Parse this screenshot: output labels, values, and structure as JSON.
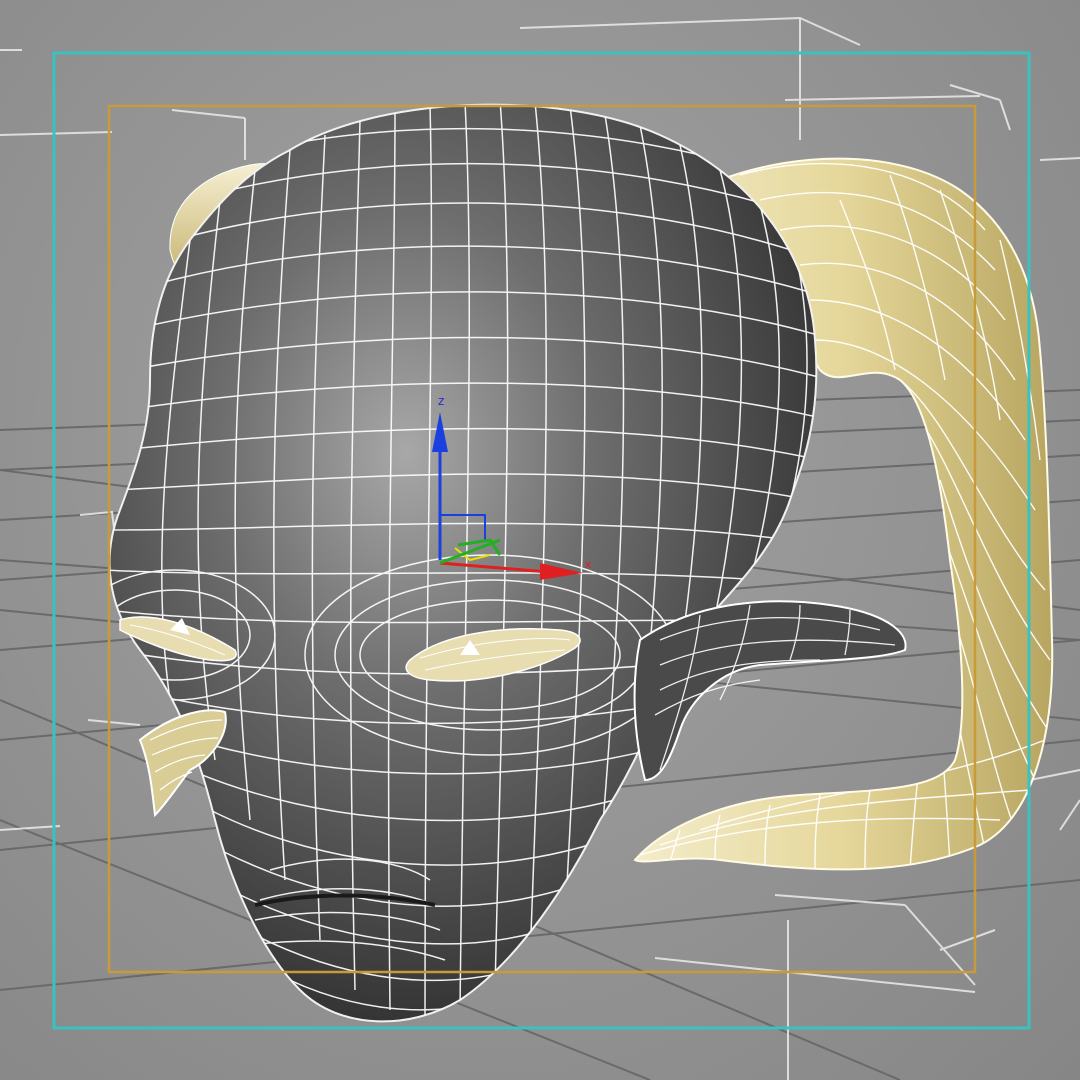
{
  "viewport": {
    "background": "#8f8f8f",
    "grid_color": "#5c5c5c",
    "safe_frame_color": "#39c2c2",
    "selection_frame_color": "#c89a3a",
    "bbox_color": "#e6e6e6"
  },
  "model": {
    "head_color": "#3f3f3f",
    "head_highlight": "#9a9a9a",
    "horn_color": "#e8dca0",
    "horn_shadow": "#b9a766",
    "wire_color": "#ffffff",
    "eye_color": "#e7ddb0"
  },
  "gizmo": {
    "x_color": "#e02020",
    "y_color": "#20b020",
    "z_color": "#1a40e0",
    "x_label": "x",
    "z_label": "z"
  },
  "tool": {
    "icons": [
      "move-gizmo-icon",
      "axis-tripod-icon"
    ]
  }
}
